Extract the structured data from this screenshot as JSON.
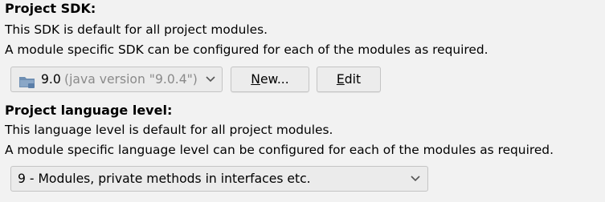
{
  "project_sdk": {
    "heading": "Project SDK:",
    "line1": "This SDK is default for all project modules.",
    "line2": "A module specific SDK can be configured for each of the modules as required.",
    "combo": {
      "icon": "folder-icon",
      "version": "9.0",
      "details": "(java version \"9.0.4\")",
      "details_color": "#8a8a8a"
    },
    "new_button": {
      "mnemonic": "N",
      "rest": "ew..."
    },
    "edit_button": {
      "mnemonic": "E",
      "rest": "dit"
    }
  },
  "language_level": {
    "heading": "Project language level:",
    "line1": "This language level is default for all project modules.",
    "line2": "A module specific language level can be configured for each of the modules as required.",
    "selected": "9 - Modules, private methods in interfaces etc."
  },
  "colors": {
    "background": "#f2f2f2",
    "folder_icon": "#6f8fb3"
  }
}
